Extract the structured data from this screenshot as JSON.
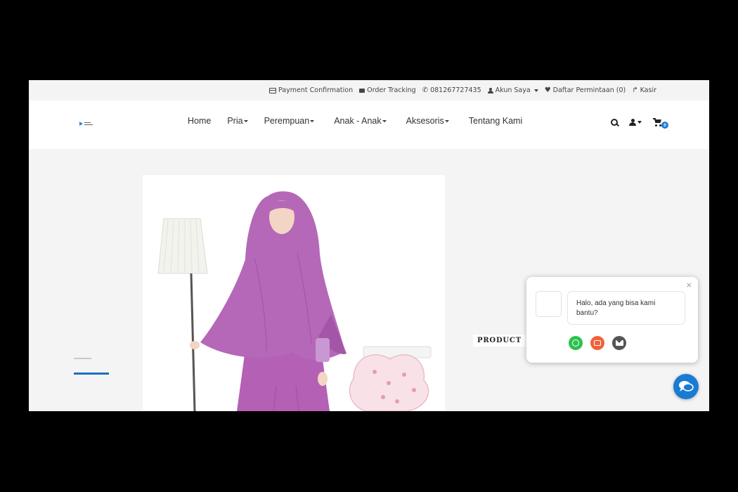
{
  "topbar": {
    "items": [
      {
        "icon": "credit-card-icon",
        "label": "Payment Confirmation"
      },
      {
        "icon": "truck-icon",
        "label": "Order Tracking"
      },
      {
        "icon": "phone-icon",
        "label": "081267727435"
      },
      {
        "icon": "user-icon",
        "label": "Akun Saya"
      },
      {
        "icon": "heart-icon",
        "label": "Daftar Permintaan (0)"
      },
      {
        "icon": "share-icon",
        "label": "Kasir"
      }
    ]
  },
  "header": {
    "nav": [
      {
        "label": "Home",
        "dropdown": false
      },
      {
        "label": "Pria",
        "dropdown": true
      },
      {
        "label": "Perempuan",
        "dropdown": true
      },
      {
        "label": "Anak - Anak",
        "dropdown": true
      },
      {
        "label": "Aksesoris",
        "dropdown": true
      },
      {
        "label": "Tentang Kami",
        "dropdown": false
      }
    ],
    "cart_count": "0"
  },
  "main": {
    "product_label": "PRODUCT"
  },
  "chat": {
    "greeting": "Halo, ada yang bisa kami bantu?",
    "close_label": "×",
    "channels": [
      "whatsapp-icon",
      "messenger-icon",
      "email-icon"
    ]
  },
  "colors": {
    "accent": "#1a7bd3",
    "hijab": "#b166b4",
    "whatsapp": "#2dc24e",
    "messenger": "#f06238",
    "email": "#555555"
  }
}
